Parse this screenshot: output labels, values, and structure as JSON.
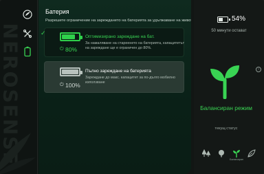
{
  "colors": {
    "accent": "#39d353",
    "panel": "#0f2a1f",
    "card_selected": "#0b1a14",
    "card_other": "#2a3a33"
  },
  "rail": {
    "brand_text": "NEROSENSE",
    "items": [
      {
        "icon": "logo-icon"
      },
      {
        "icon": "wrench-cross-icon"
      },
      {
        "icon": "battery-icon",
        "active": true
      }
    ]
  },
  "main": {
    "title": "Батерия",
    "description": "Разрешете ограничение на зареждането на батерията за удължаване на живота ѝ",
    "options": [
      {
        "selected": true,
        "title": "Оптимизирано зареждане на бат.",
        "text": "За намаляване на стареенето на батерията, капацитетът на зареждане ще е ограничен до 80%.",
        "percent": "80%",
        "level": 0.8
      },
      {
        "selected": false,
        "title": "Пълно зареждане на батерията",
        "text": "Зареждане до макс. капацитет за по-дълго мобилно използване",
        "percent": "100%",
        "level": 1.0
      }
    ]
  },
  "side": {
    "battery_percent": "54%",
    "battery_level": 0.54,
    "remaining": "50 минути остават",
    "info_icon": "info-icon",
    "mode_name": "Балансиран режим",
    "mode_caption": "текущ статус",
    "modes": [
      {
        "icon": "trees-icon",
        "label": ""
      },
      {
        "icon": "tree-icon",
        "label": ""
      },
      {
        "icon": "sprout-icon",
        "label": "Балансиран",
        "active": true
      },
      {
        "icon": "leaf-icon",
        "label": ""
      }
    ]
  }
}
